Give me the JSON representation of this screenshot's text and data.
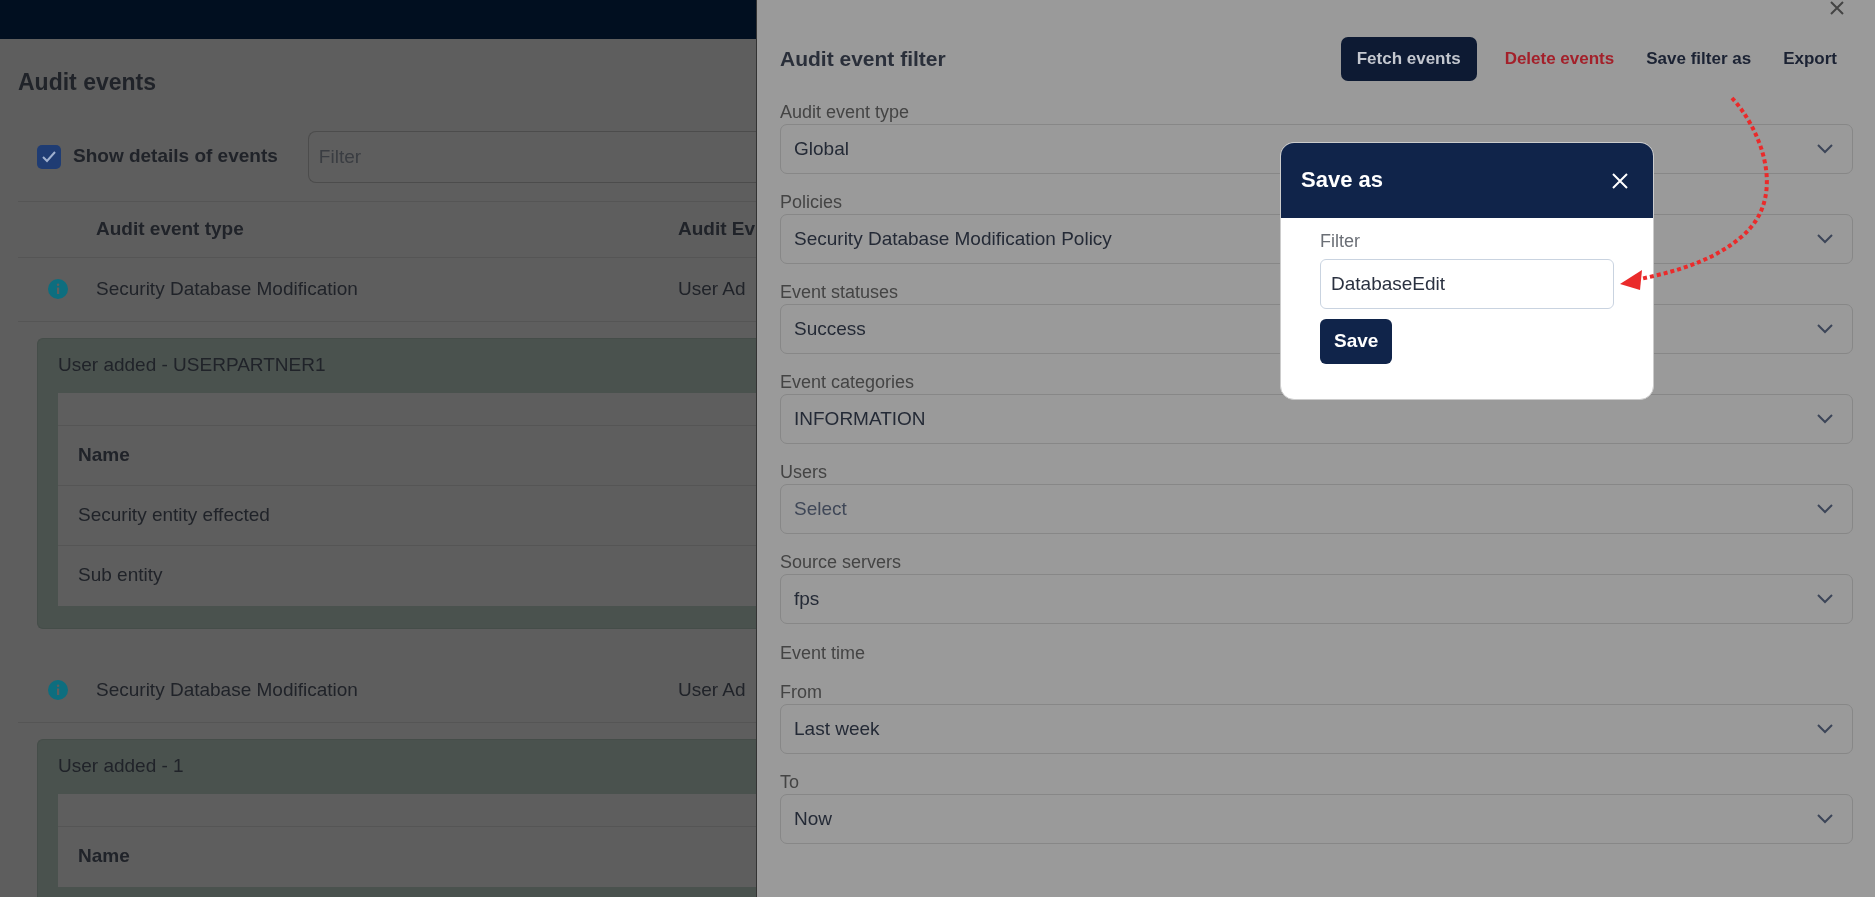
{
  "page": {
    "title": "Audit events",
    "show_details": {
      "label": "Show details of events",
      "checked": true
    },
    "filter": {
      "placeholder": "Filter"
    },
    "table": {
      "columns": [
        "Audit event type",
        "Audit Ev"
      ],
      "events": [
        {
          "type": "Security Database Modification",
          "column_2": "User Ad",
          "details": {
            "title": "User added - USERPARTNER1",
            "header": "Name",
            "rows": [
              "Security entity effected",
              "Sub entity"
            ]
          }
        },
        {
          "type": "Security Database Modification",
          "column_2": "User Ad",
          "details": {
            "title": "User added - 1",
            "header": "Name"
          }
        }
      ]
    }
  },
  "filter_panel": {
    "title": "Audit event filter",
    "actions": [
      {
        "label": "Fetch events",
        "kind": "primary"
      },
      {
        "label": "Delete events",
        "kind": "danger"
      },
      {
        "label": "Save filter as",
        "kind": "link"
      },
      {
        "label": "Export",
        "kind": "link"
      }
    ],
    "fields": [
      {
        "kind": "select",
        "label": "Audit event type",
        "value": "Global"
      },
      {
        "kind": "select",
        "label": "Policies",
        "value": "Security Database Modification Policy"
      },
      {
        "kind": "select",
        "label": "Event statuses",
        "value": "Success"
      },
      {
        "kind": "select",
        "label": "Event categories",
        "value": "INFORMATION"
      },
      {
        "kind": "select",
        "label": "Users",
        "placeholder": "Select"
      },
      {
        "kind": "select",
        "label": "Source servers",
        "value": "fps"
      },
      {
        "kind": "heading",
        "label": "Event time"
      },
      {
        "kind": "select",
        "label": "From",
        "value": "Last week"
      },
      {
        "kind": "select",
        "label": "To",
        "value": "Now"
      }
    ]
  },
  "save_dialog": {
    "title": "Save as",
    "field_label": "Filter",
    "value": "DatabaseEdit",
    "button": "Save"
  }
}
